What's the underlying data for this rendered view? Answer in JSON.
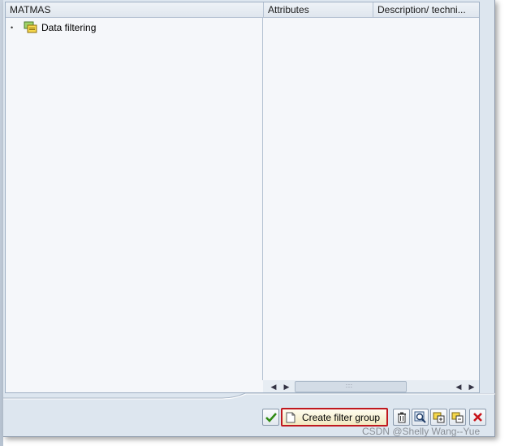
{
  "tree": {
    "columns": [
      "MATMAS",
      "Attributes",
      "Description/ techni..."
    ],
    "nodes": [
      {
        "label": "Data filtering",
        "icon": "filter-folder-icon"
      }
    ]
  },
  "toolbar": {
    "create_filter_group_label": "Create filter group",
    "buttons": [
      "check-icon",
      "document-icon",
      "trash-icon",
      "find-icon",
      "expand-icon",
      "collapse-icon",
      "close-icon"
    ]
  },
  "watermark": "CSDN @Shelly Wang--Yue"
}
